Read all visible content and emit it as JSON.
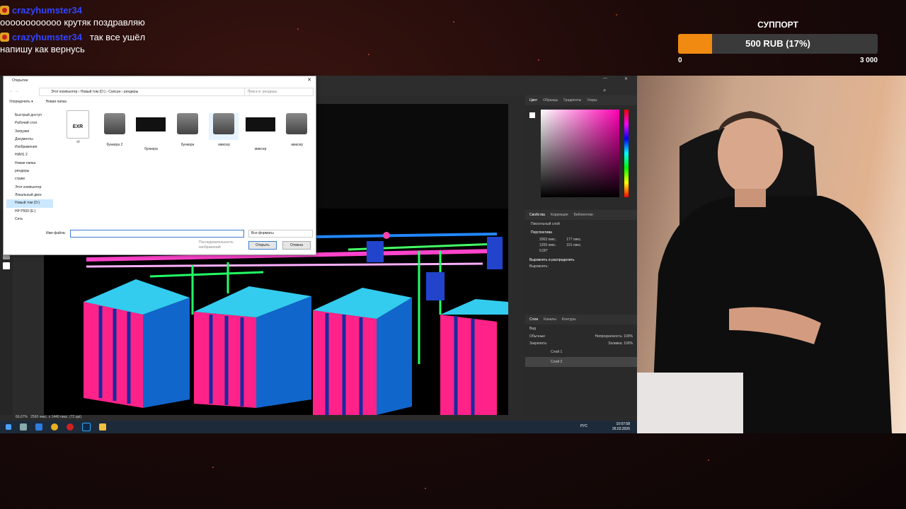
{
  "chat": {
    "messages": [
      {
        "user": "crazyhumster34",
        "text": "оооооооооооо крутяк поздравляю"
      },
      {
        "user": "crazyhumster34",
        "text": "так все ушёл напишу как вернусь"
      }
    ]
  },
  "support": {
    "title": "СУППОРТ",
    "amount_label": "500 RUB (17%)",
    "progress_fraction": 0.17,
    "min_label": "0",
    "max_label": "3 000",
    "bar_color": "#f08a10"
  },
  "dialog": {
    "title": "Открытие",
    "path": "Этот компьютер  ›  Новый том (D:)  ›  Сапсан  ›  рендеры",
    "search_placeholder": "Поиск в: рендеры",
    "organize_label": "Упорядочить ▾",
    "new_folder_label": "Новая папка",
    "sidebar": [
      "Быстрый доступ",
      "Рабочий стол",
      "Загрузки",
      "Документы",
      "Изображения",
      "НИИ1 2",
      "Новая папка",
      "рендеры",
      "стрим",
      "Этот компьютер",
      "Локальный диск",
      "Новый том (D:)",
      "HP P500 (E:)",
      "Сеть"
    ],
    "files": [
      {
        "name": "ct",
        "kind": "exr"
      },
      {
        "name": "бункера 2",
        "kind": "model"
      },
      {
        "name": "бункера",
        "kind": "dark"
      },
      {
        "name": "бункера",
        "kind": "model"
      },
      {
        "name": "миксер",
        "kind": "model"
      },
      {
        "name": "миксер",
        "kind": "dark"
      },
      {
        "name": "миксер",
        "kind": "model"
      }
    ],
    "exr_label": "EXR",
    "filename_label": "Имя файла:",
    "filename_value": "",
    "filter_label": "Все форматы",
    "sequence_label": "Последовательность изображений",
    "open_label": "Открыть",
    "cancel_label": "Отмена"
  },
  "photoshop": {
    "color_tabs": [
      "Цвет",
      "Образцы",
      "Градиенты",
      "Узоры"
    ],
    "props_tabs": [
      "Свойства",
      "Коррекция",
      "Библиотеки"
    ],
    "props_layer": "Пиксельный слой",
    "transform_title": "Перспектива",
    "w_value": "2063 пикс.",
    "x_value": "177 пикс.",
    "h_value": "1206 пикс.",
    "y_value": "101 пикс.",
    "angle_value": "0,00°",
    "align_title": "Выровнять и распределить",
    "align_sub": "Выровнять:",
    "layers_tabs": [
      "Слои",
      "Каналы",
      "Контуры"
    ],
    "layer_filter": "Вид",
    "blend_mode": "Обычные",
    "opacity_label": "Непрозрачность:",
    "opacity_value": "100%",
    "lock_label": "Закрепить:",
    "fill_label": "Заливка:",
    "fill_value": "100%",
    "layers": [
      "Слой 1",
      "Слой 2"
    ],
    "zoom_status": "66,67%",
    "doc_status": "2560 пикс. x 1440 пикс. (72 ppi)"
  },
  "taskbar": {
    "lang": "РУС",
    "time": "10:07:58",
    "date": "26.03.2026"
  }
}
